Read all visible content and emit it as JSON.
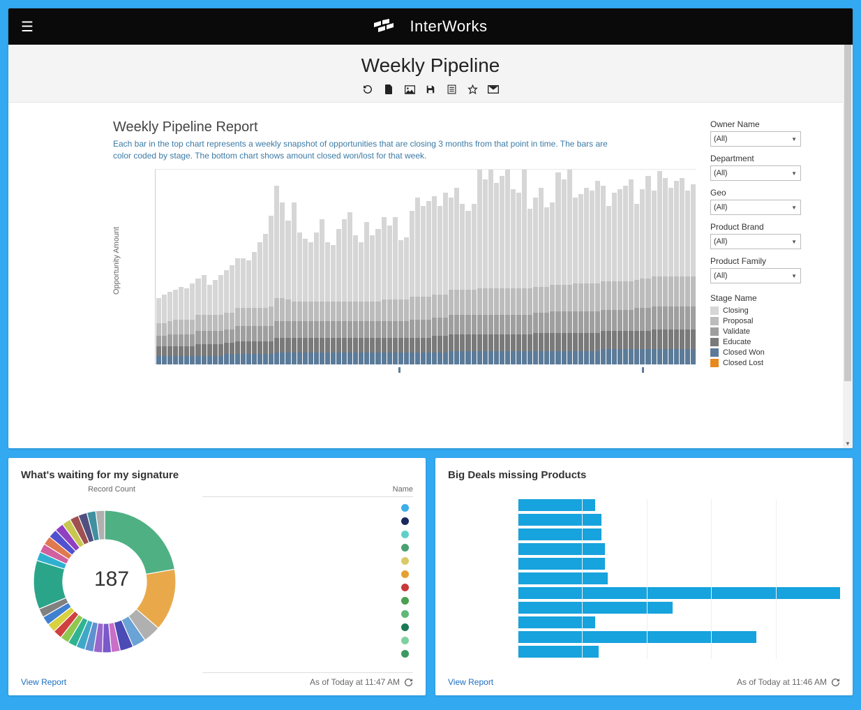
{
  "header": {
    "brand": "InterWorks",
    "page_title": "Weekly Pipeline"
  },
  "toolbar_icons": [
    "refresh-icon",
    "file-icon",
    "image-icon",
    "save-icon",
    "list-icon",
    "star-icon",
    "mail-icon"
  ],
  "report": {
    "heading": "Weekly Pipeline Report",
    "description": "Each bar in the top chart represents a weekly snapshot of opportunities that are closing 3 months from that point in time.  The bars are color coded by stage.  The bottom chart shows amount closed won/lost for that week.",
    "y_axis_label": "Opportunity Amount"
  },
  "filters": [
    {
      "label": "Owner Name",
      "value": "(All)"
    },
    {
      "label": "Department",
      "value": "(All)"
    },
    {
      "label": "Geo",
      "value": "(All)"
    },
    {
      "label": "Product Brand",
      "value": "(All)"
    },
    {
      "label": "Product Family",
      "value": "(All)"
    }
  ],
  "legend": {
    "title": "Stage Name",
    "items": [
      {
        "label": "Closing",
        "color": "#d6d6d6"
      },
      {
        "label": "Proposal",
        "color": "#bcbcbc"
      },
      {
        "label": "Validate",
        "color": "#9f9f9f"
      },
      {
        "label": "Educate",
        "color": "#7a7a7a"
      },
      {
        "label": "Closed Won",
        "color": "#5b7b99"
      },
      {
        "label": "Closed Lost",
        "color": "#e68a1f"
      }
    ]
  },
  "chart_data": {
    "type": "bar",
    "ylabel": "Opportunity Amount",
    "notes": "stacked weekly pipeline; values relative 0-100",
    "series_names": [
      "Closed Won",
      "Educate",
      "Validate",
      "Proposal",
      "Closing"
    ],
    "colors": [
      "#5b7b99",
      "#7a7a7a",
      "#9f9f9f",
      "#bcbcbc",
      "#d6d6d6"
    ],
    "stacks": [
      [
        5,
        6,
        6,
        8,
        15
      ],
      [
        5,
        6,
        6,
        8,
        17
      ],
      [
        5,
        6,
        7,
        8,
        18
      ],
      [
        5,
        6,
        7,
        9,
        18
      ],
      [
        5,
        6,
        7,
        9,
        20
      ],
      [
        5,
        6,
        7,
        9,
        19
      ],
      [
        5,
        6,
        7,
        9,
        22
      ],
      [
        5,
        7,
        8,
        10,
        22
      ],
      [
        5,
        7,
        8,
        10,
        24
      ],
      [
        5,
        7,
        8,
        10,
        18
      ],
      [
        5,
        7,
        8,
        10,
        21
      ],
      [
        5,
        7,
        8,
        10,
        24
      ],
      [
        6,
        7,
        8,
        10,
        26
      ],
      [
        6,
        7,
        8,
        10,
        29
      ],
      [
        6,
        8,
        9,
        11,
        30
      ],
      [
        6,
        8,
        9,
        11,
        30
      ],
      [
        6,
        8,
        9,
        11,
        29
      ],
      [
        6,
        8,
        9,
        11,
        34
      ],
      [
        6,
        8,
        9,
        11,
        40
      ],
      [
        6,
        8,
        9,
        11,
        45
      ],
      [
        6,
        8,
        9,
        12,
        55
      ],
      [
        7,
        9,
        10,
        14,
        68
      ],
      [
        7,
        9,
        10,
        14,
        58
      ],
      [
        7,
        9,
        10,
        13,
        48
      ],
      [
        7,
        9,
        10,
        12,
        60
      ],
      [
        7,
        9,
        10,
        12,
        42
      ],
      [
        7,
        9,
        10,
        12,
        38
      ],
      [
        7,
        9,
        10,
        12,
        36
      ],
      [
        7,
        9,
        10,
        12,
        42
      ],
      [
        7,
        9,
        10,
        12,
        50
      ],
      [
        7,
        9,
        10,
        12,
        36
      ],
      [
        7,
        9,
        10,
        12,
        34
      ],
      [
        7,
        9,
        10,
        12,
        44
      ],
      [
        7,
        9,
        10,
        12,
        50
      ],
      [
        7,
        9,
        10,
        12,
        54
      ],
      [
        7,
        9,
        10,
        12,
        40
      ],
      [
        7,
        9,
        10,
        12,
        36
      ],
      [
        7,
        9,
        10,
        12,
        48
      ],
      [
        7,
        9,
        10,
        12,
        40
      ],
      [
        7,
        9,
        10,
        12,
        44
      ],
      [
        7,
        9,
        10,
        13,
        50
      ],
      [
        7,
        9,
        10,
        13,
        45
      ],
      [
        7,
        9,
        10,
        13,
        50
      ],
      [
        7,
        9,
        10,
        13,
        36
      ],
      [
        7,
        9,
        10,
        13,
        38
      ],
      [
        7,
        9,
        11,
        14,
        52
      ],
      [
        7,
        9,
        11,
        14,
        60
      ],
      [
        7,
        9,
        11,
        14,
        55
      ],
      [
        7,
        9,
        11,
        14,
        58
      ],
      [
        7,
        10,
        11,
        14,
        60
      ],
      [
        7,
        10,
        11,
        14,
        54
      ],
      [
        7,
        10,
        11,
        14,
        62
      ],
      [
        8,
        10,
        12,
        15,
        56
      ],
      [
        8,
        10,
        12,
        15,
        62
      ],
      [
        8,
        10,
        12,
        15,
        52
      ],
      [
        8,
        10,
        12,
        15,
        48
      ],
      [
        8,
        10,
        12,
        15,
        52
      ],
      [
        8,
        10,
        12,
        16,
        74
      ],
      [
        8,
        10,
        12,
        16,
        66
      ],
      [
        8,
        10,
        12,
        16,
        78
      ],
      [
        8,
        10,
        12,
        16,
        64
      ],
      [
        8,
        10,
        12,
        16,
        68
      ],
      [
        8,
        10,
        12,
        16,
        72
      ],
      [
        8,
        10,
        12,
        16,
        60
      ],
      [
        8,
        10,
        12,
        16,
        58
      ],
      [
        8,
        10,
        12,
        16,
        72
      ],
      [
        8,
        10,
        12,
        16,
        48
      ],
      [
        8,
        11,
        12,
        16,
        54
      ],
      [
        8,
        11,
        12,
        16,
        60
      ],
      [
        8,
        11,
        12,
        16,
        48
      ],
      [
        8,
        11,
        13,
        16,
        50
      ],
      [
        8,
        11,
        13,
        16,
        68
      ],
      [
        8,
        11,
        13,
        16,
        64
      ],
      [
        8,
        11,
        13,
        16,
        70
      ],
      [
        8,
        11,
        13,
        17,
        52
      ],
      [
        8,
        11,
        13,
        17,
        54
      ],
      [
        8,
        11,
        13,
        17,
        58
      ],
      [
        8,
        11,
        13,
        17,
        56
      ],
      [
        8,
        11,
        13,
        17,
        62
      ],
      [
        9,
        11,
        13,
        17,
        58
      ],
      [
        9,
        11,
        13,
        17,
        46
      ],
      [
        9,
        11,
        13,
        17,
        54
      ],
      [
        9,
        11,
        13,
        17,
        56
      ],
      [
        9,
        11,
        13,
        17,
        58
      ],
      [
        9,
        11,
        13,
        17,
        62
      ],
      [
        9,
        11,
        14,
        17,
        46
      ],
      [
        9,
        11,
        14,
        18,
        54
      ],
      [
        9,
        11,
        14,
        18,
        62
      ],
      [
        9,
        12,
        14,
        18,
        52
      ],
      [
        9,
        12,
        14,
        18,
        64
      ],
      [
        9,
        12,
        14,
        18,
        60
      ],
      [
        9,
        12,
        14,
        18,
        54
      ],
      [
        9,
        12,
        14,
        18,
        58
      ],
      [
        9,
        12,
        14,
        18,
        60
      ],
      [
        9,
        12,
        14,
        18,
        52
      ],
      [
        9,
        12,
        14,
        18,
        56
      ]
    ]
  },
  "widgets": {
    "signature": {
      "title": "What's waiting for my signature",
      "column_label": "Record Count",
      "legend_header": "Name",
      "center_value": "187",
      "view_report": "View Report",
      "timestamp": "As of Today at 11:47 AM",
      "donut_segments": [
        {
          "value": 22,
          "color": "#4fb083"
        },
        {
          "value": 14,
          "color": "#e9a94a"
        },
        {
          "value": 4,
          "color": "#b0b0b0"
        },
        {
          "value": 3,
          "color": "#6aa3d5"
        },
        {
          "value": 3,
          "color": "#4b4bb5"
        },
        {
          "value": 2,
          "color": "#c86fc8"
        },
        {
          "value": 2,
          "color": "#7a59c9"
        },
        {
          "value": 2,
          "color": "#9966cc"
        },
        {
          "value": 2,
          "color": "#6090d0"
        },
        {
          "value": 2,
          "color": "#3fa8c8"
        },
        {
          "value": 2,
          "color": "#30b390"
        },
        {
          "value": 2,
          "color": "#8fc850"
        },
        {
          "value": 2,
          "color": "#d04040"
        },
        {
          "value": 2,
          "color": "#d8d140"
        },
        {
          "value": 2,
          "color": "#4080d0"
        },
        {
          "value": 2,
          "color": "#808080"
        },
        {
          "value": 11,
          "color": "#2aa58a"
        },
        {
          "value": 2,
          "color": "#30b0d0"
        },
        {
          "value": 2,
          "color": "#d060a0"
        },
        {
          "value": 2,
          "color": "#e07850"
        },
        {
          "value": 2,
          "color": "#5050d0"
        },
        {
          "value": 2,
          "color": "#9040c0"
        },
        {
          "value": 2,
          "color": "#c8c850"
        },
        {
          "value": 2,
          "color": "#a05050"
        },
        {
          "value": 2,
          "color": "#505080"
        },
        {
          "value": 2,
          "color": "#4090a0"
        },
        {
          "value": 2,
          "color": "#b0b0b0"
        }
      ],
      "legend_dots": [
        "#3eaee8",
        "#1a2a5e",
        "#5fd0c8",
        "#4aa070",
        "#d8ca68",
        "#e6a030",
        "#c83a3a",
        "#4aa050",
        "#5fb878",
        "#1a7a55",
        "#7fd0a0",
        "#3a9a60"
      ]
    },
    "bigdeals": {
      "title": "Big Deals missing Products",
      "view_report": "View Report",
      "timestamp": "As of Today at 11:46 AM",
      "bars": [
        24,
        26,
        26,
        27,
        27,
        28,
        100,
        48,
        24,
        74,
        25
      ]
    }
  }
}
